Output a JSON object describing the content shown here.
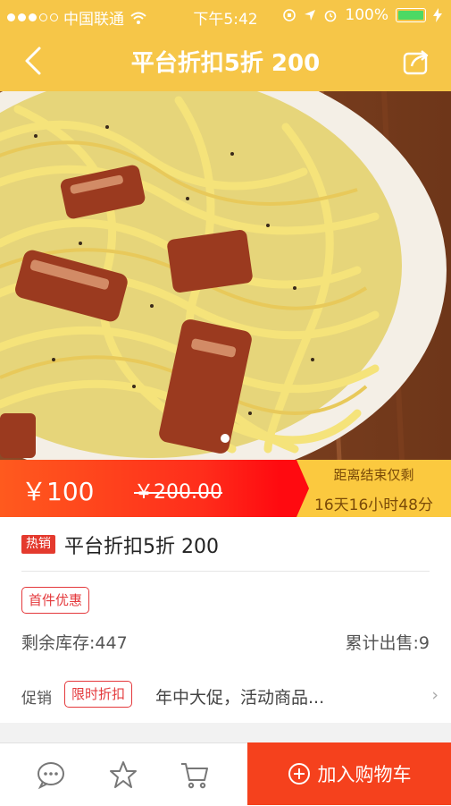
{
  "status": {
    "carrier": "中国联通",
    "time": "下午5:42",
    "battery": "100%"
  },
  "nav": {
    "title": "平台折扣5折  200"
  },
  "hero": {
    "image_desc": "carbonara-spaghetti-photo",
    "slide_count": 1
  },
  "price": {
    "current": "￥100",
    "original": "￥200.00"
  },
  "countdown": {
    "label": "距离结束仅剩",
    "value": "16天16小时48分"
  },
  "product": {
    "hot_tag": "热销",
    "title": "平台折扣5折  200",
    "first_tag": "首件优惠",
    "stock": "剩余库存:447",
    "sold": "累计出售:9",
    "promo_label": "促销",
    "promo_tag": "限时折扣",
    "promo_text": "年中大促，活动商品...",
    "promo_arrow": "›"
  },
  "bottom": {
    "add_to_cart": "加入购物车"
  },
  "colors": {
    "brand": "#f6c648",
    "accent_red": "#f5411d"
  }
}
